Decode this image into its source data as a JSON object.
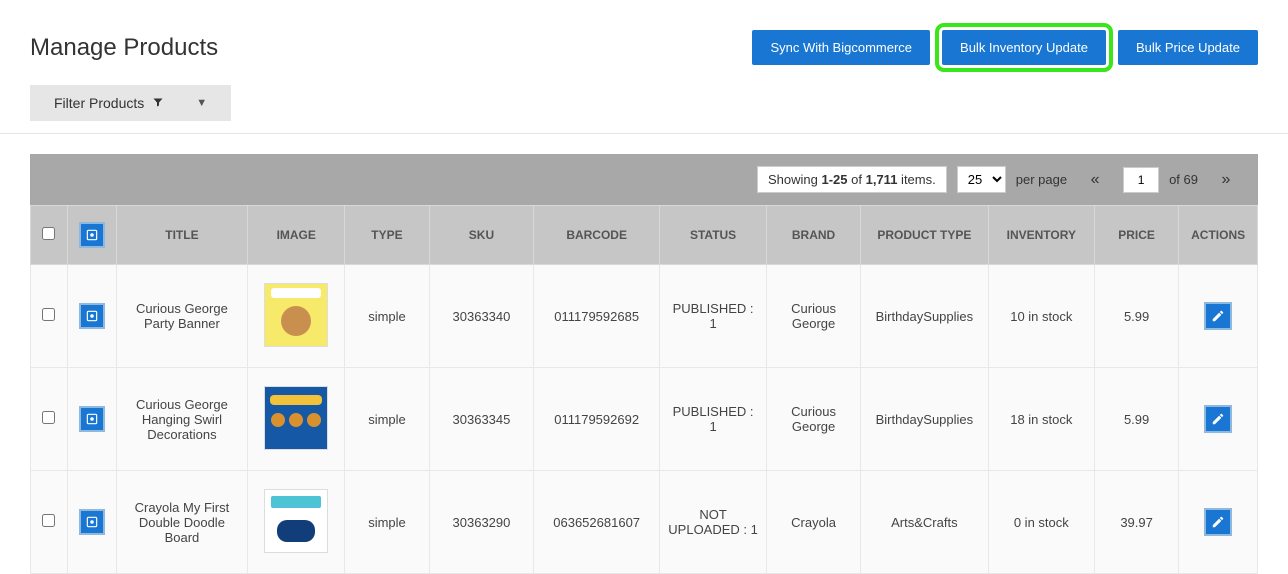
{
  "header": {
    "title": "Manage Products",
    "buttons": {
      "sync": "Sync With Bigcommerce",
      "bulk_inventory": "Bulk Inventory Update",
      "bulk_price": "Bulk Price Update"
    }
  },
  "filter": {
    "label": "Filter Products"
  },
  "pager": {
    "showing_prefix": "Showing ",
    "range": "1-25",
    "of_word": " of ",
    "total": "1,711",
    "items_word": " items.",
    "per_page_options": [
      "25"
    ],
    "per_page_selected": "25",
    "per_page_label": "per page",
    "prev": "«",
    "current_page": "1",
    "of_pages_prefix": "of ",
    "total_pages": "69",
    "next": "»"
  },
  "columns": {
    "title": "TITLE",
    "image": "IMAGE",
    "type": "TYPE",
    "sku": "SKU",
    "barcode": "BARCODE",
    "status": "STATUS",
    "brand": "BRAND",
    "product_type": "PRODUCT TYPE",
    "inventory": "INVENTORY",
    "price": "PRICE",
    "actions": "ACTIONS"
  },
  "rows": [
    {
      "title": "Curious George Party Banner",
      "type": "simple",
      "sku": "30363340",
      "barcode": "011179592685",
      "status": "PUBLISHED : 1",
      "brand": "Curious George",
      "product_type": "BirthdaySupplies",
      "inventory": "10 in stock",
      "price": "5.99",
      "thumb_class": "thumb1"
    },
    {
      "title": "Curious George Hanging Swirl Decorations",
      "type": "simple",
      "sku": "30363345",
      "barcode": "011179592692",
      "status": "PUBLISHED : 1",
      "brand": "Curious George",
      "product_type": "BirthdaySupplies",
      "inventory": "18 in stock",
      "price": "5.99",
      "thumb_class": "thumb2"
    },
    {
      "title": "Crayola My First Double Doodle Board",
      "type": "simple",
      "sku": "30363290",
      "barcode": "063652681607",
      "status": "NOT UPLOADED : 1",
      "brand": "Crayola",
      "product_type": "Arts&Crafts",
      "inventory": "0 in stock",
      "price": "39.97",
      "thumb_class": "thumb3"
    }
  ]
}
